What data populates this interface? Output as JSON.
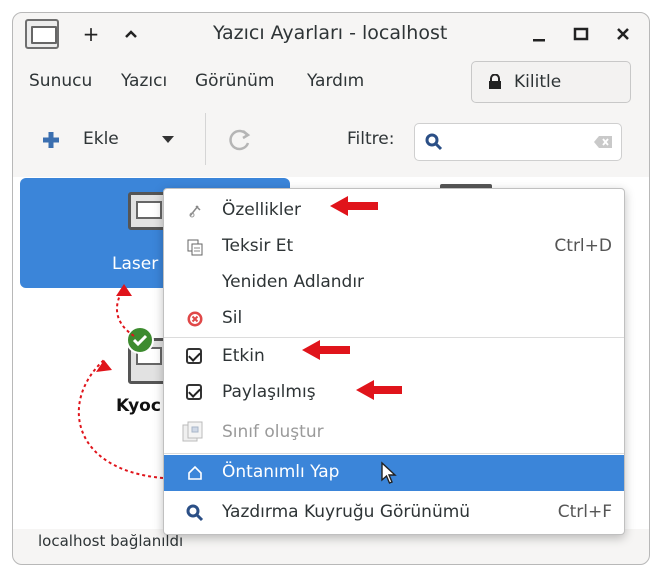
{
  "window": {
    "title": "Yazıcı Ayarları - localhost",
    "title_buttons": {
      "add": "+",
      "up": "^",
      "minimize": "_",
      "maximize": "□",
      "close": "×"
    }
  },
  "menubar": {
    "items": [
      "Sunucu",
      "Yazıcı",
      "Görünüm",
      "Yardım"
    ],
    "lock_label": "Kilitle"
  },
  "toolbar": {
    "add_label": "Ekle",
    "filter_label": "Filtre:",
    "search_value": ""
  },
  "printers": [
    {
      "label": "Laser",
      "selected": true
    },
    {
      "label": "Kyoc",
      "selected": false
    }
  ],
  "context_menu": {
    "items": [
      {
        "label": "Özellikler",
        "accel": "",
        "icon": "properties-icon",
        "state": "normal"
      },
      {
        "label": "Teksir Et",
        "accel": "Ctrl+D",
        "icon": "copy-icon",
        "state": "normal"
      },
      {
        "label": "Yeniden Adlandır",
        "accel": "",
        "icon": "",
        "state": "normal"
      },
      {
        "label": "Sil",
        "accel": "",
        "icon": "delete-icon",
        "state": "normal"
      },
      {
        "label": "Etkin",
        "accel": "",
        "icon": "checkbox",
        "state": "checked"
      },
      {
        "label": "Paylaşılmış",
        "accel": "",
        "icon": "checkbox",
        "state": "checked"
      },
      {
        "label": "Sınıf oluştur",
        "accel": "",
        "icon": "class-icon",
        "state": "disabled"
      },
      {
        "label": "Öntanımlı Yap",
        "accel": "",
        "icon": "home-icon",
        "state": "highlighted"
      },
      {
        "label": "Yazdırma Kuyruğu Görünümü",
        "accel": "Ctrl+F",
        "icon": "search-icon",
        "state": "normal"
      }
    ]
  },
  "status": {
    "text": "localhost bağlanıldı"
  },
  "colors": {
    "accent": "#3b85d9",
    "annotation": "#e0141b",
    "default_badge": "#3d8b2f"
  }
}
